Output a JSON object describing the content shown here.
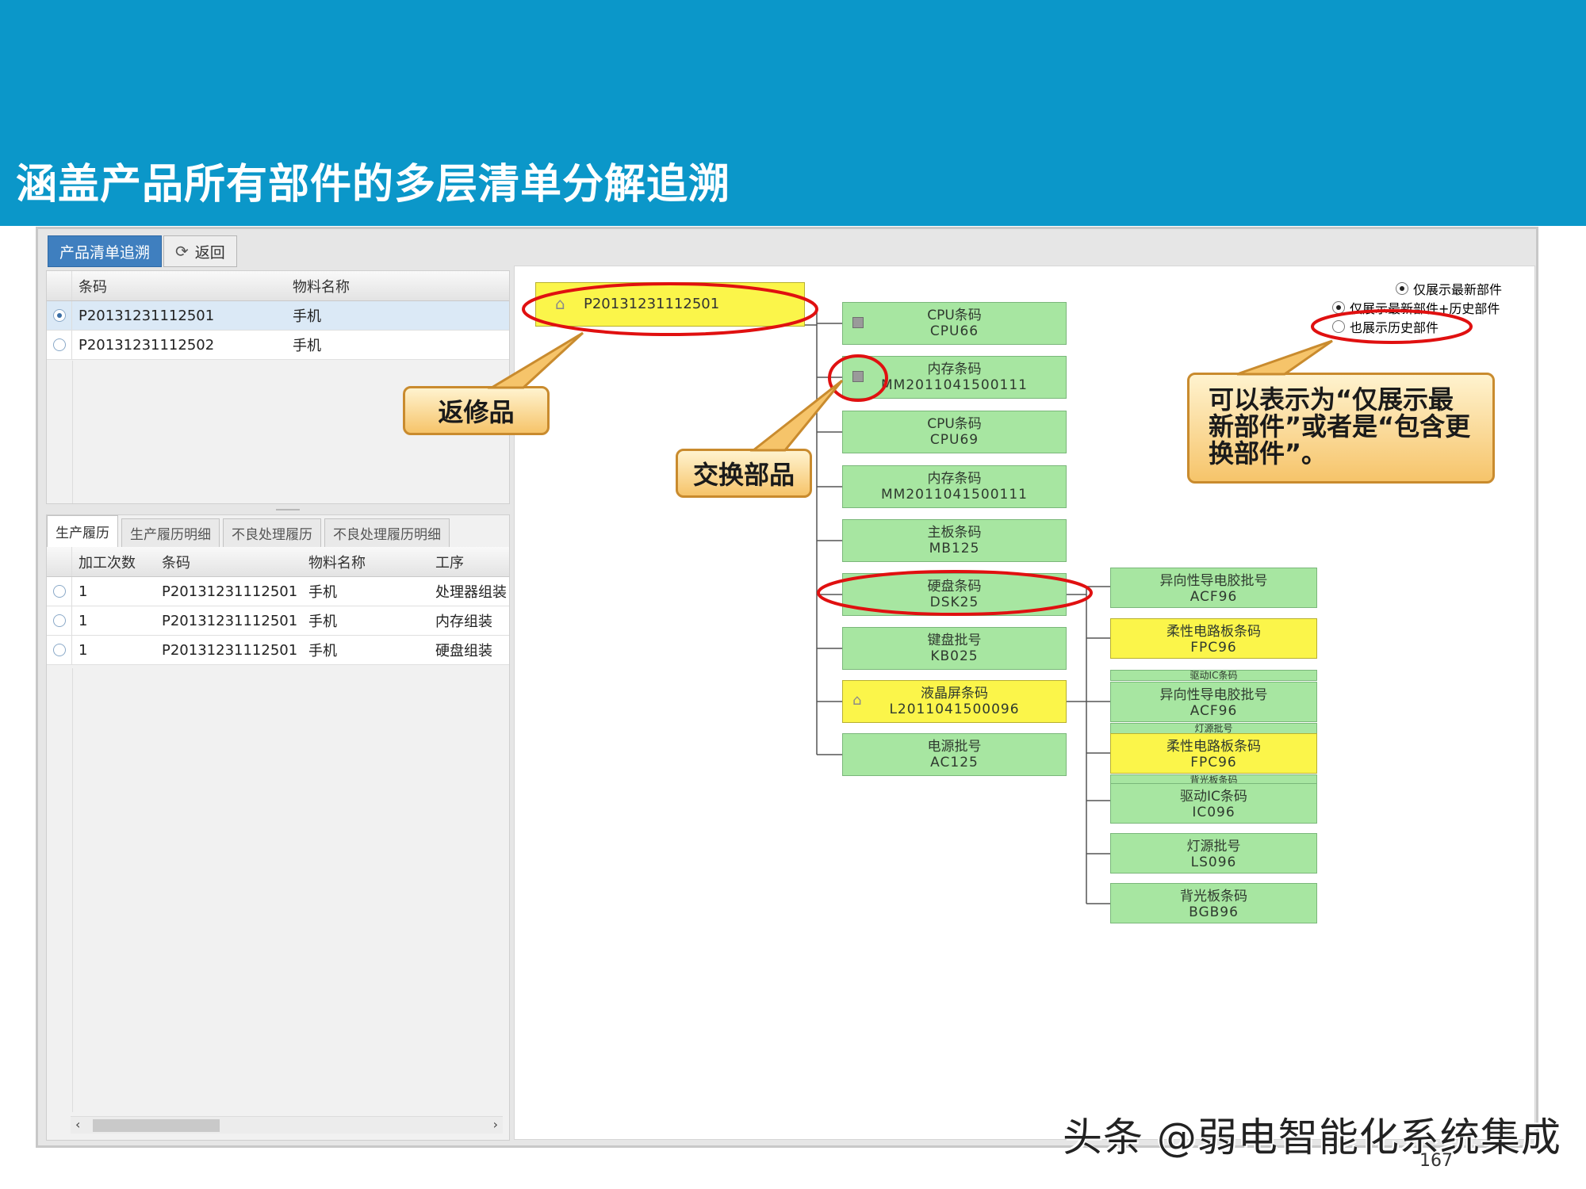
{
  "slide": {
    "title": "涵盖产品所有部件的多层清单分解追溯"
  },
  "toolbar": {
    "trace_label": "产品清单追溯",
    "back_label": "返回"
  },
  "top_grid": {
    "columns": [
      "条码",
      "物料名称"
    ],
    "rows": [
      {
        "barcode": "P20131231112501",
        "name": "手机"
      },
      {
        "barcode": "P20131231112502",
        "name": "手机"
      }
    ]
  },
  "history": {
    "tabs": [
      "生产履历",
      "生产履历明细",
      "不良处理履历",
      "不良处理履历明细"
    ],
    "columns": [
      "加工次数",
      "条码",
      "物料名称",
      "工序"
    ],
    "rows": [
      {
        "count": "1",
        "barcode": "P20131231112501",
        "name": "手机",
        "process": "处理器组装"
      },
      {
        "count": "1",
        "barcode": "P20131231112501",
        "name": "手机",
        "process": "内存组装"
      },
      {
        "count": "1",
        "barcode": "P20131231112501",
        "name": "手机",
        "process": "硬盘组装"
      }
    ]
  },
  "tree": {
    "root": "P20131231112501",
    "level1": [
      {
        "label": "CPU条码",
        "code": "CPU66",
        "color": "green"
      },
      {
        "label": "内存条码",
        "code": "MM2011041500111",
        "color": "green"
      },
      {
        "label": "CPU条码",
        "code": "CPU69",
        "color": "green"
      },
      {
        "label": "内存条码",
        "code": "MM2011041500111",
        "color": "green"
      },
      {
        "label": "主板条码",
        "code": "MB125",
        "color": "green"
      },
      {
        "label": "硬盘条码",
        "code": "DSK25",
        "color": "green"
      },
      {
        "label": "键盘批号",
        "code": "KB025",
        "color": "green"
      },
      {
        "label": "液晶屏条码",
        "code": "L2011041500096",
        "color": "yellow"
      },
      {
        "label": "电源批号",
        "code": "AC125",
        "color": "green"
      }
    ],
    "level2": [
      {
        "label": "异向性导电胶批号",
        "code": "ACF96",
        "color": "green"
      },
      {
        "label": "柔性电路板条码",
        "code": "FPC96",
        "color": "yellow"
      },
      {
        "label": "异向性导电胶批号",
        "code": "ACF96",
        "color": "green"
      },
      {
        "label": "柔性电路板条码",
        "code": "FPC96",
        "color": "yellow"
      },
      {
        "label": "驱动IC条码",
        "code": "IC096",
        "color": "green"
      },
      {
        "label": "灯源批号",
        "code": "LS096",
        "color": "green"
      },
      {
        "label": "背光板条码",
        "code": "BGB96",
        "color": "green"
      }
    ],
    "strips": [
      "驱动IC条码",
      "灯源批号",
      "背光板条码"
    ]
  },
  "options": {
    "opt1": "仅展示最新部件",
    "opt2": "仅展示最新部件+历史部件",
    "opt3": "也展示历史部件"
  },
  "callouts": {
    "repair": "返修品",
    "swap": "交换部品",
    "note": "可以表示为“仅展示最新部件”或者是“包含更换部件”。"
  },
  "footer": {
    "watermark": "头条 @弱电智能化系统集成",
    "page": "167"
  },
  "colors": {
    "header": "#0b97c9",
    "node_green": "#a7e6a1",
    "node_yellow": "#fbf54a",
    "annotation_red": "#e01010",
    "callout": "#f6c46a"
  }
}
